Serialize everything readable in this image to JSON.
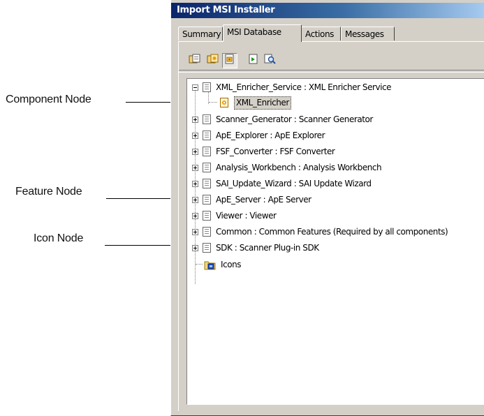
{
  "callouts": {
    "component": "Component Node",
    "feature": "Feature Node",
    "icon": "Icon Node"
  },
  "window": {
    "title": "Import MSI Installer",
    "tabs": [
      {
        "label": "Summary",
        "active": false
      },
      {
        "label": "MSI Database",
        "active": true
      },
      {
        "label": "Actions",
        "active": false
      },
      {
        "label": "Messages",
        "active": false
      }
    ]
  },
  "toolbar": {
    "buttons": [
      {
        "icon": "feature-view-icon"
      },
      {
        "icon": "component-view-icon"
      },
      {
        "icon": "feature-component-view-icon",
        "pressed": true
      },
      {
        "icon": "export-icon"
      },
      {
        "icon": "find-icon"
      }
    ]
  },
  "tree": {
    "root_feature": "XML_Enricher_Service : XML Enricher Service",
    "component": "XML_Enricher",
    "features": [
      "Scanner_Generator : Scanner Generator",
      "ApE_Explorer : ApE Explorer",
      "FSF_Converter : FSF Converter",
      "Analysis_Workbench : Analysis Workbench",
      "SAI_Update_Wizard : SAI Update Wizard",
      "ApE_Server : ApE Server",
      "Viewer : Viewer",
      "Common : Common Features (Required by all components)",
      "SDK : Scanner Plug-in SDK"
    ],
    "icons_node": "Icons"
  },
  "colors": {
    "titlebar": "#0a246a",
    "face": "#d4d0c8",
    "tree_bg": "#ffffff"
  }
}
